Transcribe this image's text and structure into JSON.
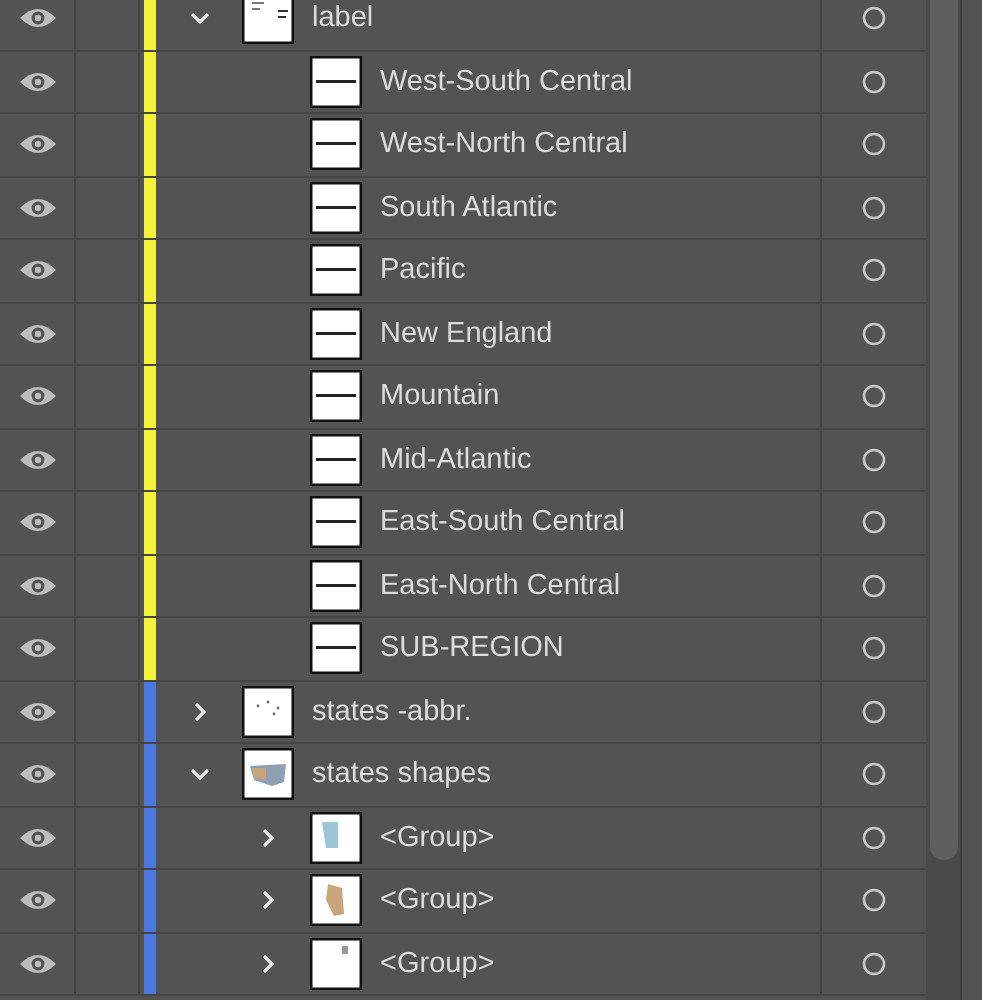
{
  "layers": [
    {
      "name": "label",
      "color": "#f5f23a",
      "visible": true,
      "expanded": true,
      "children": [
        {
          "name": "West-South Central",
          "visible": true
        },
        {
          "name": "West-North Central",
          "visible": true
        },
        {
          "name": "South Atlantic",
          "visible": true
        },
        {
          "name": "Pacific",
          "visible": true
        },
        {
          "name": "New England",
          "visible": true
        },
        {
          "name": "Mountain",
          "visible": true
        },
        {
          "name": "Mid-Atlantic",
          "visible": true
        },
        {
          "name": "East-South Central",
          "visible": true
        },
        {
          "name": "East-North Central",
          "visible": true
        },
        {
          "name": "SUB-REGION",
          "visible": true
        }
      ]
    },
    {
      "name": "states -abbr.",
      "color": "#4a78e0",
      "visible": true,
      "expanded": false
    },
    {
      "name": "states shapes",
      "color": "#4a78e0",
      "visible": true,
      "expanded": true,
      "children": [
        {
          "name": "<Group>",
          "visible": true,
          "expanded": false
        },
        {
          "name": "<Group>",
          "visible": true,
          "expanded": false
        },
        {
          "name": "<Group>",
          "visible": true,
          "expanded": false
        }
      ]
    }
  ]
}
